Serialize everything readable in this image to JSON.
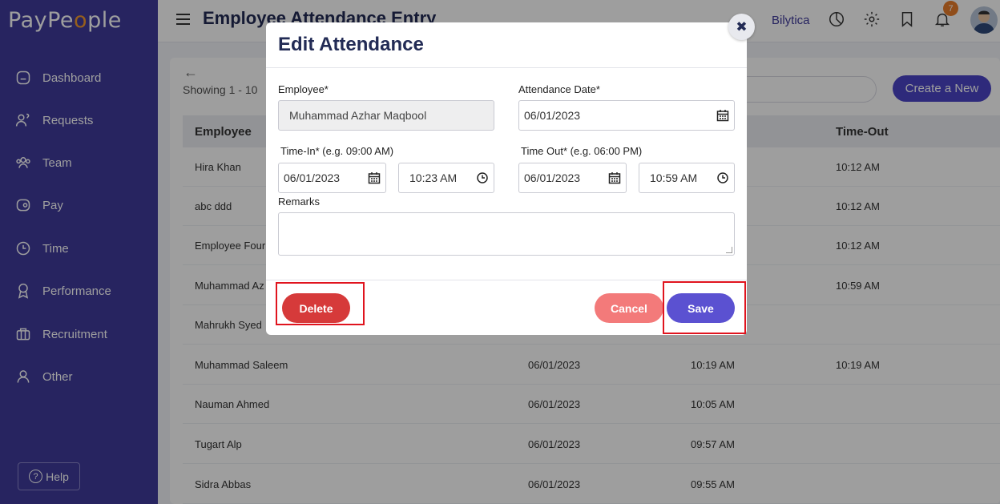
{
  "app": {
    "logo_prefix": "PayPe",
    "logo_o": "o",
    "logo_suffix": "ple"
  },
  "sidebar": {
    "items": [
      {
        "label": "Dashboard",
        "icon": "home-icon"
      },
      {
        "label": "Requests",
        "icon": "requests-icon"
      },
      {
        "label": "Team",
        "icon": "team-icon"
      },
      {
        "label": "Pay",
        "icon": "wallet-icon"
      },
      {
        "label": "Time",
        "icon": "clock-icon"
      },
      {
        "label": "Performance",
        "icon": "award-icon"
      },
      {
        "label": "Recruitment",
        "icon": "briefcase-icon"
      },
      {
        "label": "Other",
        "icon": "user-icon"
      }
    ],
    "help": "Help"
  },
  "header": {
    "title": "Employee Attendance Entry",
    "company": "Bilytica",
    "notification_count": "7"
  },
  "main": {
    "showing": "Showing 1 - 10",
    "create_label": "Create a New",
    "columns": [
      "Employee",
      "Time-Out"
    ],
    "rows": [
      {
        "employee": "Hira Khan",
        "date": "",
        "time_in": "",
        "time_out": "10:12 AM"
      },
      {
        "employee": "abc ddd",
        "date": "",
        "time_in": "",
        "time_out": "10:12 AM"
      },
      {
        "employee": "Employee Four",
        "date": "",
        "time_in": "",
        "time_out": "10:12 AM"
      },
      {
        "employee": "Muhammad Az",
        "date": "",
        "time_in": "",
        "time_out": "10:59 AM"
      },
      {
        "employee": "Mahrukh Syed",
        "date": "",
        "time_in": "",
        "time_out": ""
      },
      {
        "employee": "Muhammad Saleem",
        "date": "06/01/2023",
        "time_in": "10:19 AM",
        "time_out": "10:19 AM"
      },
      {
        "employee": "Nauman Ahmed",
        "date": "06/01/2023",
        "time_in": "10:05 AM",
        "time_out": ""
      },
      {
        "employee": "Tugart Alp",
        "date": "06/01/2023",
        "time_in": "09:57 AM",
        "time_out": ""
      },
      {
        "employee": "Sidra Abbas",
        "date": "06/01/2023",
        "time_in": "09:55 AM",
        "time_out": ""
      }
    ]
  },
  "modal": {
    "title": "Edit Attendance",
    "employee_label": "Employee*",
    "employee_value": "Muhammad Azhar Maqbool",
    "date_label": "Attendance Date*",
    "date_value": "06/01/2023",
    "time_in_label": "Time-In* (e.g. 09:00 AM)",
    "time_in_date": "06/01/2023",
    "time_in_time": "10:23 AM",
    "time_out_label": "Time Out* (e.g. 06:00 PM)",
    "time_out_date": "06/01/2023",
    "time_out_time": "10:59 AM",
    "remarks_label": "Remarks",
    "remarks_value": "",
    "delete_label": "Delete",
    "cancel_label": "Cancel",
    "save_label": "Save",
    "close_symbol": "✖"
  },
  "colors": {
    "sidebar": "#3f3a9c",
    "primary": "#5b51d1",
    "danger": "#d63a3a",
    "highlight": "#e0141e"
  }
}
